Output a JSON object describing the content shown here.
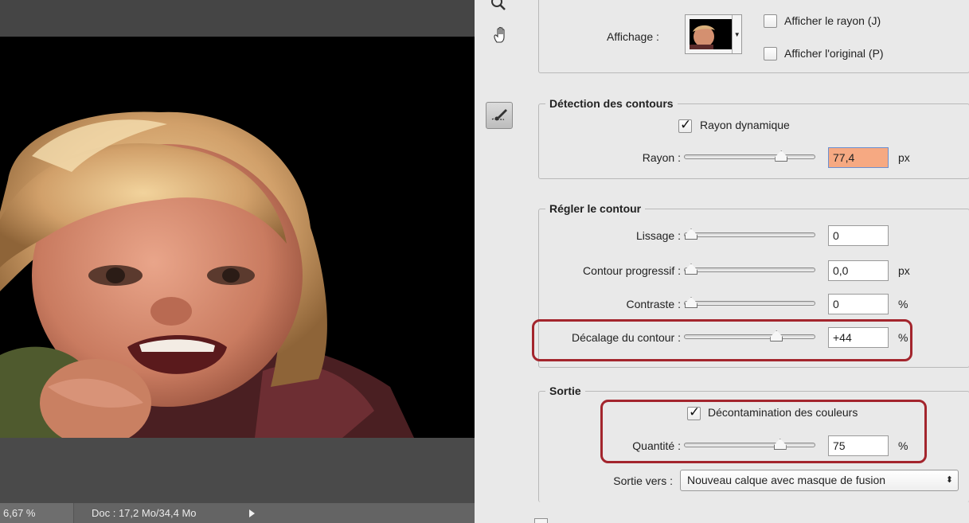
{
  "canvas": {
    "status_zoom": "6,67 %",
    "status_doc": "Doc : 17,2 Mo/34,4 Mo"
  },
  "tools": {
    "zoom": "zoom-icon",
    "hand": "hand-icon",
    "brush": "refine-radius-brush-icon"
  },
  "affichage": {
    "label": "Affichage :",
    "show_radius": "Afficher le rayon (J)",
    "show_original": "Afficher l'original (P)",
    "show_radius_checked": false,
    "show_original_checked": false
  },
  "detection": {
    "title": "Détection des contours",
    "smart_radius": "Rayon dynamique",
    "smart_radius_checked": true,
    "radius_label": "Rayon :",
    "radius_value": "77,4",
    "radius_unit": "px",
    "radius_fraction": 0.76
  },
  "adjust": {
    "title": "Régler le contour",
    "smooth_label": "Lissage :",
    "smooth_value": "0",
    "smooth_fraction": 0,
    "feather_label": "Contour progressif :",
    "feather_value": "0,0",
    "feather_unit": "px",
    "feather_fraction": 0,
    "contrast_label": "Contraste :",
    "contrast_value": "0",
    "contrast_unit": "%",
    "contrast_fraction": 0,
    "shift_label": "Décalage du contour :",
    "shift_value": "+44",
    "shift_unit": "%",
    "shift_fraction": 0.72
  },
  "output": {
    "title": "Sortie",
    "decontaminate": "Décontamination des couleurs",
    "decontaminate_checked": true,
    "amount_label": "Quantité :",
    "amount_value": "75",
    "amount_unit": "%",
    "amount_fraction": 0.75,
    "output_to_label": "Sortie vers :",
    "output_to_value": "Nouveau calque avec masque de fusion"
  },
  "colors": {
    "highlight": "#a3252d",
    "radius_field_bg": "#f6a982"
  }
}
